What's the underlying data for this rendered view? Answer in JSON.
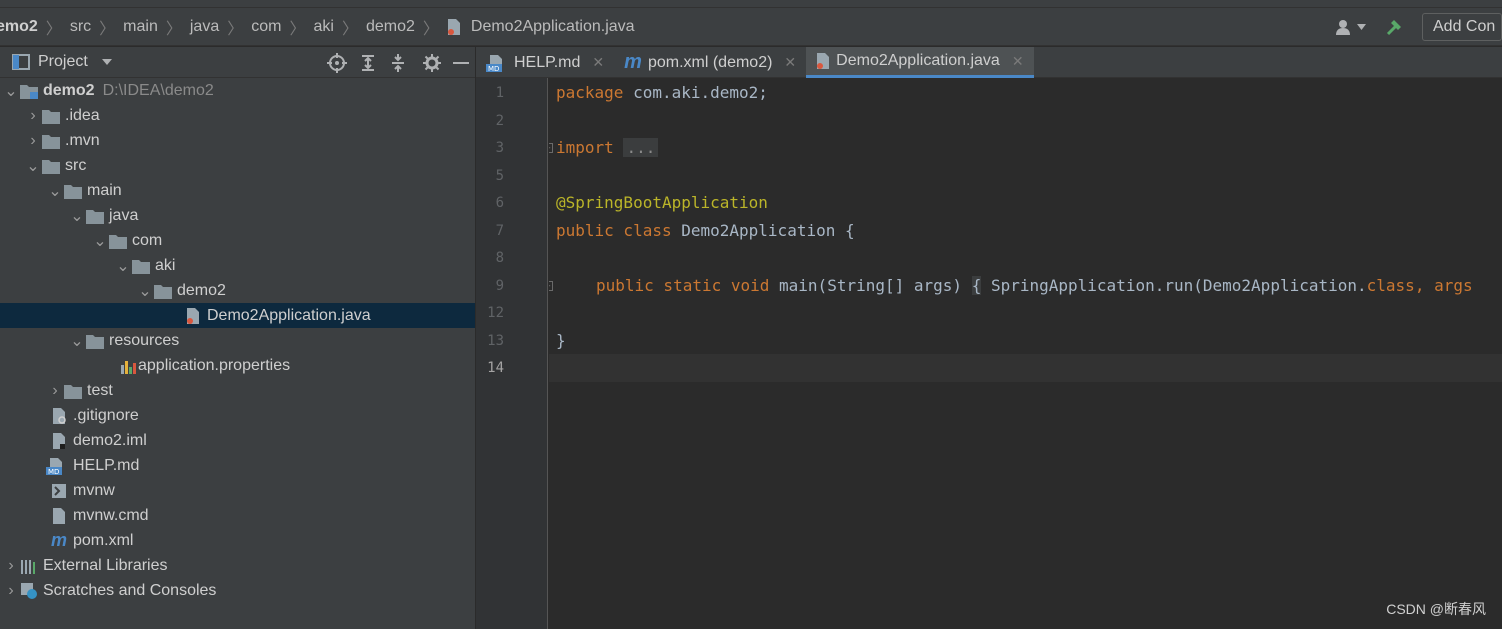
{
  "breadcrumb": [
    "emo2",
    "src",
    "main",
    "java",
    "com",
    "aki",
    "demo2",
    "Demo2Application.java"
  ],
  "toolbar": {
    "add_config_label": "Add Con"
  },
  "project_panel": {
    "title": "Project"
  },
  "tree": {
    "root": {
      "label": "demo2",
      "path": "D:\\IDEA\\demo2"
    },
    "items": [
      ".idea",
      ".mvn",
      "src",
      "main",
      "java",
      "com",
      "aki",
      "demo2",
      "Demo2Application.java",
      "resources",
      "application.properties",
      "test",
      ".gitignore",
      "demo2.iml",
      "HELP.md",
      "mvnw",
      "mvnw.cmd",
      "pom.xml",
      "External Libraries",
      "Scratches and Consoles"
    ]
  },
  "tabs": [
    {
      "label": "HELP.md"
    },
    {
      "label": "pom.xml (demo2)"
    },
    {
      "label": "Demo2Application.java"
    }
  ],
  "editor": {
    "line_numbers": [
      "1",
      "2",
      "3",
      "5",
      "6",
      "7",
      "8",
      "9",
      "12",
      "13",
      "14"
    ],
    "code": {
      "l1_kw": "package",
      "l1_rest": " com.aki.demo2;",
      "l3_kw": "import",
      "l3_ellipsis": "...",
      "l6_ann": "@SpringBootApplication",
      "l7_kw": "public class",
      "l7_rest": " Demo2Application {",
      "l9_kw": "public static void",
      "l9_sig": " main(String[] args) ",
      "l9_brace": "{",
      "l9_body": " SpringApplication.run(Demo2Application.",
      "l9_kw2": "class",
      "l9_tail": ", args",
      "l13": "}"
    }
  },
  "watermark": "CSDN @断春风",
  "colors": {
    "keyword": "#cc7832",
    "annotation": "#bbb529",
    "selection": "#0d293e",
    "tab_underline": "#4a88c7"
  }
}
